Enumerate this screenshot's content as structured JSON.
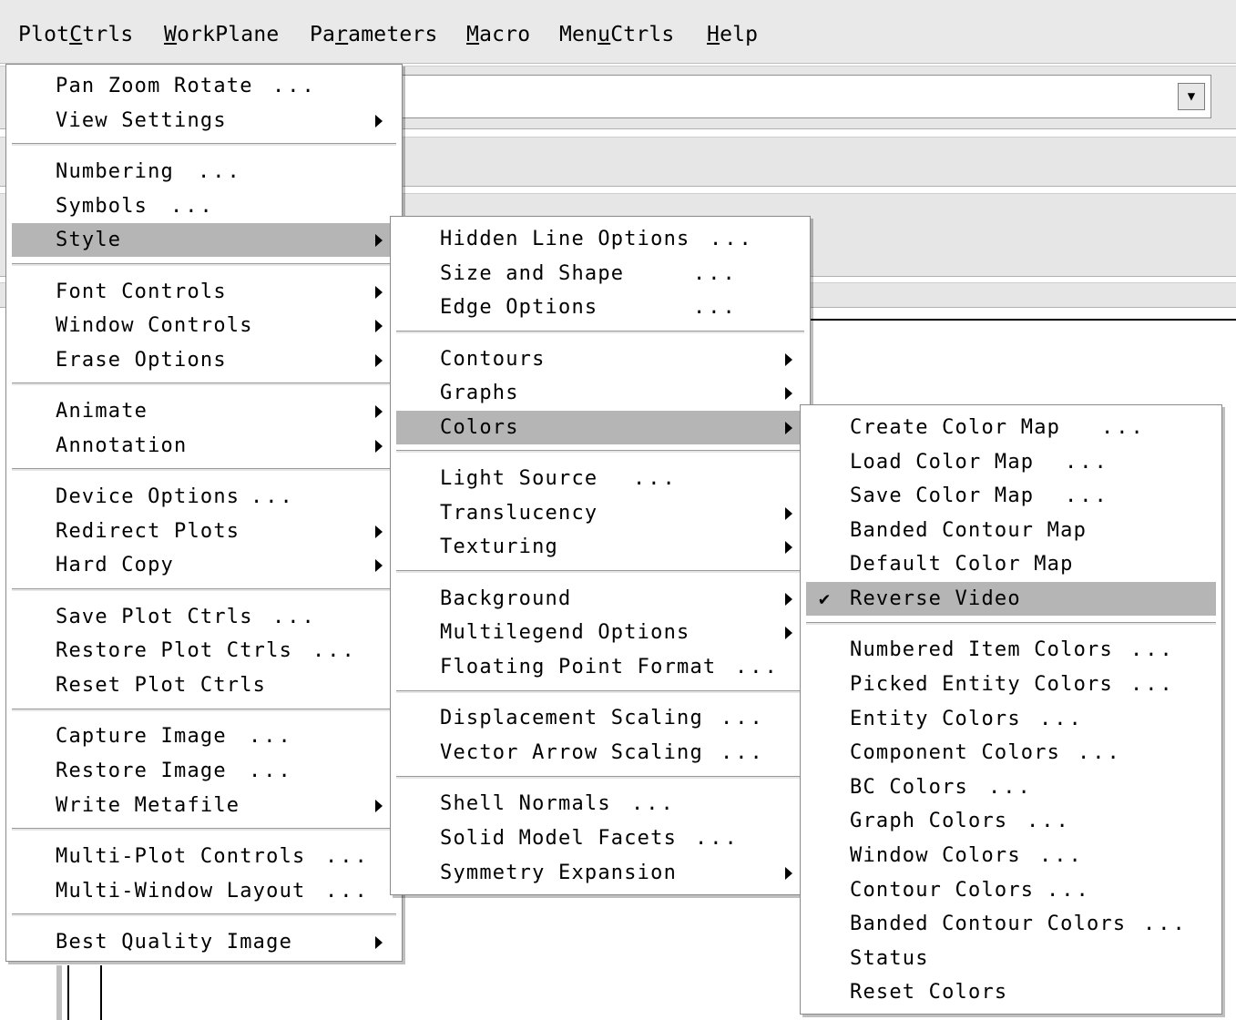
{
  "menubar": {
    "items": [
      {
        "label": "PlotCtrls",
        "mnemonic_index": 4
      },
      {
        "label": "WorkPlane",
        "mnemonic_index": 0
      },
      {
        "label": "Parameters",
        "mnemonic_index": 2
      },
      {
        "label": "Macro",
        "mnemonic_index": 0
      },
      {
        "label": "MenuCtrls",
        "mnemonic_index": 3
      },
      {
        "label": "Help",
        "mnemonic_index": 0
      }
    ]
  },
  "plotctrls_menu": {
    "items": [
      {
        "label": "Pan Zoom Rotate",
        "dots": "...",
        "submenu": false
      },
      {
        "label": "View Settings",
        "dots": "",
        "submenu": true
      },
      {
        "separator": true
      },
      {
        "label": "Numbering",
        "dots": "...",
        "submenu": false
      },
      {
        "label": "Symbols",
        "dots": "...",
        "submenu": false
      },
      {
        "label": "Style",
        "dots": "",
        "submenu": true,
        "highlighted": true
      },
      {
        "separator": true
      },
      {
        "label": "Font Controls",
        "dots": "",
        "submenu": true
      },
      {
        "label": "Window Controls",
        "dots": "",
        "submenu": true
      },
      {
        "label": "Erase Options",
        "dots": "",
        "submenu": true
      },
      {
        "separator": true
      },
      {
        "label": "Animate",
        "dots": "",
        "submenu": true
      },
      {
        "label": "Annotation",
        "dots": "",
        "submenu": true
      },
      {
        "separator": true
      },
      {
        "label": "Device Options",
        "dots": "...",
        "submenu": false
      },
      {
        "label": "Redirect Plots",
        "dots": "",
        "submenu": true
      },
      {
        "label": "Hard Copy",
        "dots": "",
        "submenu": true
      },
      {
        "separator": true
      },
      {
        "label": "Save Plot Ctrls",
        "dots": "...",
        "submenu": false
      },
      {
        "label": "Restore Plot Ctrls",
        "dots": "...",
        "submenu": false
      },
      {
        "label": "Reset Plot Ctrls",
        "dots": "",
        "submenu": false
      },
      {
        "separator": true
      },
      {
        "label": "Capture Image",
        "dots": "...",
        "submenu": false
      },
      {
        "label": "Restore Image",
        "dots": "...",
        "submenu": false
      },
      {
        "label": "Write Metafile",
        "dots": "",
        "submenu": true
      },
      {
        "separator": true
      },
      {
        "label": "Multi-Plot Controls",
        "dots": "...",
        "submenu": false
      },
      {
        "label": "Multi-Window Layout",
        "dots": "...",
        "submenu": false
      },
      {
        "separator": true
      },
      {
        "label": "Best Quality Image",
        "dots": "",
        "submenu": true
      }
    ]
  },
  "style_menu": {
    "items": [
      {
        "label": "Hidden Line Options",
        "dots": "...",
        "submenu": false
      },
      {
        "label": "Size and Shape",
        "dots": "...",
        "submenu": false
      },
      {
        "label": "Edge Options",
        "dots": "...",
        "submenu": false
      },
      {
        "separator": true
      },
      {
        "label": "Contours",
        "dots": "",
        "submenu": true
      },
      {
        "label": "Graphs",
        "dots": "",
        "submenu": true
      },
      {
        "label": "Colors",
        "dots": "",
        "submenu": true,
        "highlighted": true
      },
      {
        "separator": true
      },
      {
        "label": "Light Source",
        "dots": "...",
        "submenu": false
      },
      {
        "label": "Translucency",
        "dots": "",
        "submenu": true
      },
      {
        "label": "Texturing",
        "dots": "",
        "submenu": true
      },
      {
        "separator": true
      },
      {
        "label": "Background",
        "dots": "",
        "submenu": true
      },
      {
        "label": "Multilegend Options",
        "dots": "",
        "submenu": true
      },
      {
        "label": "Floating Point Format",
        "dots": "...",
        "submenu": false
      },
      {
        "separator": true
      },
      {
        "label": "Displacement Scaling",
        "dots": "...",
        "submenu": false
      },
      {
        "label": "Vector Arrow Scaling",
        "dots": "...",
        "submenu": false
      },
      {
        "separator": true
      },
      {
        "label": "Shell Normals",
        "dots": "...",
        "submenu": false
      },
      {
        "label": "Solid Model Facets",
        "dots": "...",
        "submenu": false
      },
      {
        "label": "Symmetry Expansion",
        "dots": "",
        "submenu": true
      }
    ]
  },
  "colors_menu": {
    "items": [
      {
        "label": "Create Color Map",
        "dots": "...",
        "submenu": false
      },
      {
        "label": "Load Color Map",
        "dots": "...",
        "submenu": false
      },
      {
        "label": "Save Color Map",
        "dots": "...",
        "submenu": false
      },
      {
        "label": "Banded Contour Map",
        "dots": "",
        "submenu": false
      },
      {
        "label": "Default Color Map",
        "dots": "",
        "submenu": false
      },
      {
        "label": "Reverse Video",
        "dots": "",
        "submenu": false,
        "highlighted": true,
        "checked": true
      },
      {
        "separator": true
      },
      {
        "label": "Numbered Item Colors",
        "dots": "...",
        "submenu": false
      },
      {
        "label": "Picked Entity Colors",
        "dots": "...",
        "submenu": false
      },
      {
        "label": "Entity Colors",
        "dots": "...",
        "submenu": false
      },
      {
        "label": "Component Colors",
        "dots": "...",
        "submenu": false
      },
      {
        "label": "BC Colors",
        "dots": "...",
        "submenu": false
      },
      {
        "label": "Graph Colors",
        "dots": "...",
        "submenu": false
      },
      {
        "label": "Window Colors",
        "dots": "...",
        "submenu": false
      },
      {
        "label": "Contour Colors",
        "dots": "...",
        "submenu": false
      },
      {
        "label": "Banded Contour Colors",
        "dots": "...",
        "submenu": false
      },
      {
        "label": "Status",
        "dots": "",
        "submenu": false
      },
      {
        "label": "Reset Colors",
        "dots": "",
        "submenu": false
      }
    ]
  },
  "colors": {
    "menubar_bg": "#e9e9e9",
    "menu_bg": "#ffffff",
    "highlight_bg": "#b5b5b5",
    "text": "#000000"
  },
  "icons": {
    "submenu_arrow": "triangle-right-icon",
    "check": "checkmark-icon",
    "dropdown": "dropdown-arrow-icon"
  }
}
